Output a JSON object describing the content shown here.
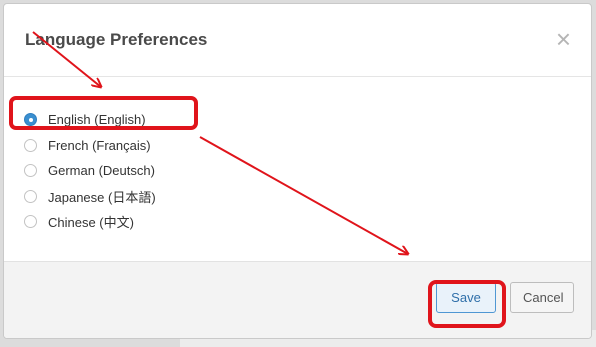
{
  "dialog": {
    "title": "Language Preferences",
    "close_label": "×"
  },
  "languages": [
    {
      "label": "English (English)",
      "selected": true
    },
    {
      "label": "French (Français)",
      "selected": false
    },
    {
      "label": "German (Deutsch)",
      "selected": false
    },
    {
      "label": "Japanese (日本語)",
      "selected": false
    },
    {
      "label": "Chinese (中文)",
      "selected": false
    }
  ],
  "footer": {
    "save_label": "Save",
    "cancel_label": "Cancel"
  },
  "colors": {
    "accent": "#3a8fd0",
    "annotation": "#e0141b"
  }
}
